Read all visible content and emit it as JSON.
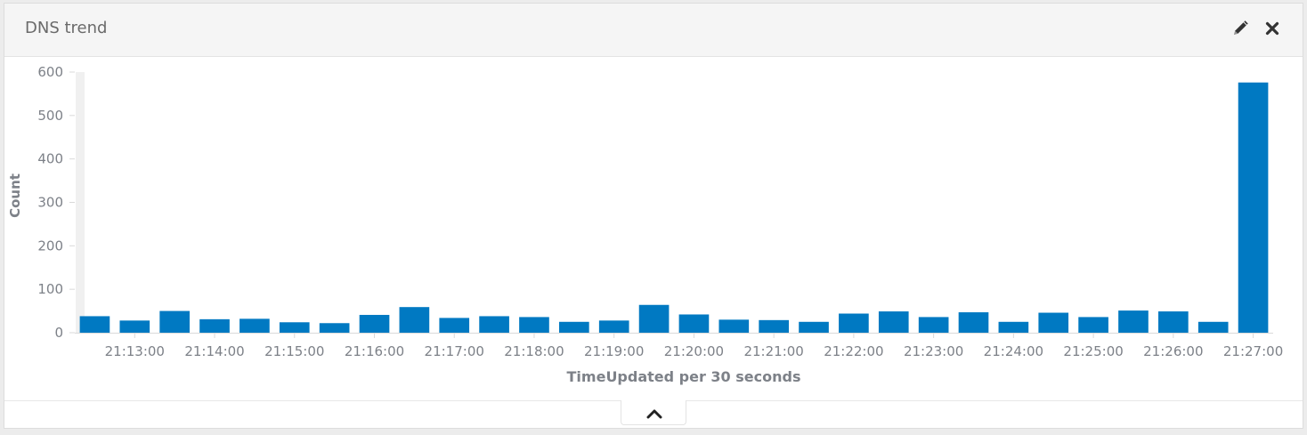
{
  "panel": {
    "title": "DNS trend",
    "edit_icon": "pencil-icon",
    "close_icon": "close-icon",
    "collapse_icon": "chevron-up-icon"
  },
  "colors": {
    "bar": "#0079c2",
    "axis_text": "#7d8188",
    "axis_title": "#7d8188",
    "baseline": "#d9d9d9",
    "header_bg": "#f5f5f5"
  },
  "chart_data": {
    "type": "bar",
    "xlabel": "TimeUpdated per 30 seconds",
    "ylabel": "Count",
    "ylim": [
      0,
      600
    ],
    "yticks": [
      0,
      100,
      200,
      300,
      400,
      500,
      600
    ],
    "grid": false,
    "x_tick_labels": [
      "21:13:00",
      "21:14:00",
      "21:15:00",
      "21:16:00",
      "21:17:00",
      "21:18:00",
      "21:19:00",
      "21:20:00",
      "21:21:00",
      "21:22:00",
      "21:23:00",
      "21:24:00",
      "21:25:00",
      "21:26:00",
      "21:27:00"
    ],
    "categories": [
      "21:12:30",
      "21:13:00",
      "21:13:30",
      "21:14:00",
      "21:14:30",
      "21:15:00",
      "21:15:30",
      "21:16:00",
      "21:16:30",
      "21:17:00",
      "21:17:30",
      "21:18:00",
      "21:18:30",
      "21:19:00",
      "21:19:30",
      "21:20:00",
      "21:20:30",
      "21:21:00",
      "21:21:30",
      "21:22:00",
      "21:22:30",
      "21:23:00",
      "21:23:30",
      "21:24:00",
      "21:24:30",
      "21:25:00",
      "21:25:30",
      "21:26:00",
      "21:26:30",
      "21:27:00"
    ],
    "values": [
      38,
      28,
      50,
      31,
      32,
      24,
      22,
      41,
      59,
      34,
      38,
      36,
      25,
      28,
      64,
      42,
      30,
      29,
      25,
      44,
      49,
      36,
      47,
      25,
      46,
      36,
      51,
      49,
      25,
      576
    ]
  }
}
